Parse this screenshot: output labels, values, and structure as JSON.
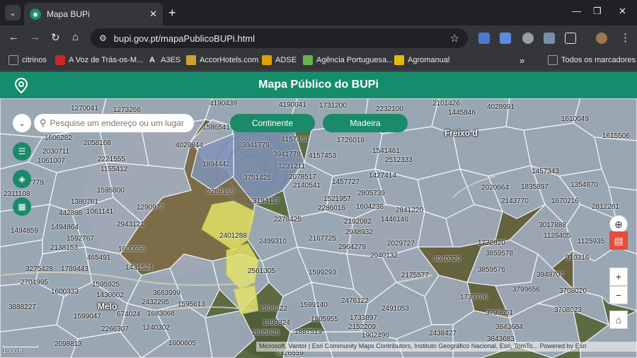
{
  "browser": {
    "tab_title": "Mapa BUPi",
    "new_tab_icon": "+",
    "url": "bupi.gov.pt/mapaPublicoBUPi.html",
    "bookmarks": [
      {
        "label": "citrinos",
        "icon": "folder-icon",
        "color": "#9aa0a6"
      },
      {
        "label": "A Voz de Trás-os-M...",
        "icon": "news-icon",
        "color": "#c62828"
      },
      {
        "label": "A3ES",
        "icon": "a3es-icon",
        "color": "#e8eaed"
      },
      {
        "label": "AccorHotels.com",
        "icon": "accor-icon",
        "color": "#c9a227"
      },
      {
        "label": "ADSE",
        "icon": "adse-icon",
        "color": "#e0a000"
      },
      {
        "label": "Agência Portuguesa...",
        "icon": "apa-icon",
        "color": "#6ab04c"
      },
      {
        "label": "Agromanual",
        "icon": "agromanual-icon",
        "color": "#e6b800"
      }
    ],
    "more_bookmarks": "»",
    "all_bookmarks": "Todos os marcadores"
  },
  "app": {
    "title": "Mapa Público do BUPi",
    "brand_color": "#158c6b"
  },
  "search": {
    "placeholder": "Pesquise um endereço ou um lugar"
  },
  "regions": [
    "Continente",
    "Madeira"
  ],
  "zoom": {
    "in": "+",
    "out": "−"
  },
  "scale_label": "1000 ft",
  "attribution": "Microsoft, Vantor | Esri Community Maps Contributors, Instituto Geográfico Nacional, Esri, TomTo...   Powered by Esri",
  "places": [
    "Freixo d",
    "Melo"
  ],
  "parcel_labels": [
    "1270041",
    "1273266",
    "4190439",
    "4190041",
    "1731200",
    "2232100",
    "2101426",
    "4028991",
    "1606282",
    "2058168",
    "1586541",
    "4157464",
    "1726018",
    "1541461",
    "2512333",
    "1445846",
    "1610049",
    "2030711",
    "1061007",
    "2221555",
    "1155412",
    "4029844",
    "3941779",
    "3941778",
    "4157453",
    "1894442",
    "1231211",
    "2078517",
    "1427414",
    "1457343",
    "1835897",
    "1354870",
    "1615506",
    "1597779",
    "2311108",
    "1595800",
    "3751425",
    "2140541",
    "1457727",
    "2805739",
    "2020664",
    "1380761",
    "442898",
    "1061141",
    "1290977",
    "2759169",
    "3194117",
    "1521957",
    "2286016",
    "1604238",
    "2841220",
    "2143770",
    "1670216",
    "2812281",
    "1494864",
    "2943121",
    "2278425",
    "2192082",
    "1446146",
    "1494859",
    "1592767",
    "2138153",
    "1600556",
    "2401288",
    "2499310",
    "2948932",
    "2167725",
    "2964279",
    "2029727",
    "1722820",
    "3017888",
    "1126405",
    "1125935",
    "465491",
    "1431524",
    "2040132",
    "4040720",
    "3859578",
    "910316",
    "3275428",
    "1789443",
    "2561305",
    "1599293",
    "2175577",
    "3859576",
    "3949707",
    "2704995",
    "1595925",
    "1600333",
    "1430602",
    "3663999",
    "2432295",
    "1595613",
    "1599140",
    "2476122",
    "1733706",
    "3799656",
    "3708020",
    "3888227",
    "1683068",
    "2491053",
    "3708023",
    "1599047",
    "674024",
    "1399322",
    "1805955",
    "1733897",
    "3799651",
    "2266307",
    "1240302",
    "1399324",
    "1887519",
    "2152209",
    "3843684",
    "2805625",
    "1902490",
    "2438427",
    "1600605",
    "2098813",
    "3843683",
    "4126559"
  ],
  "colors": {
    "parcel_fill": "#aab8d4",
    "highlight_fill": "#e6e66a",
    "map_bg": "#5c6a44"
  }
}
